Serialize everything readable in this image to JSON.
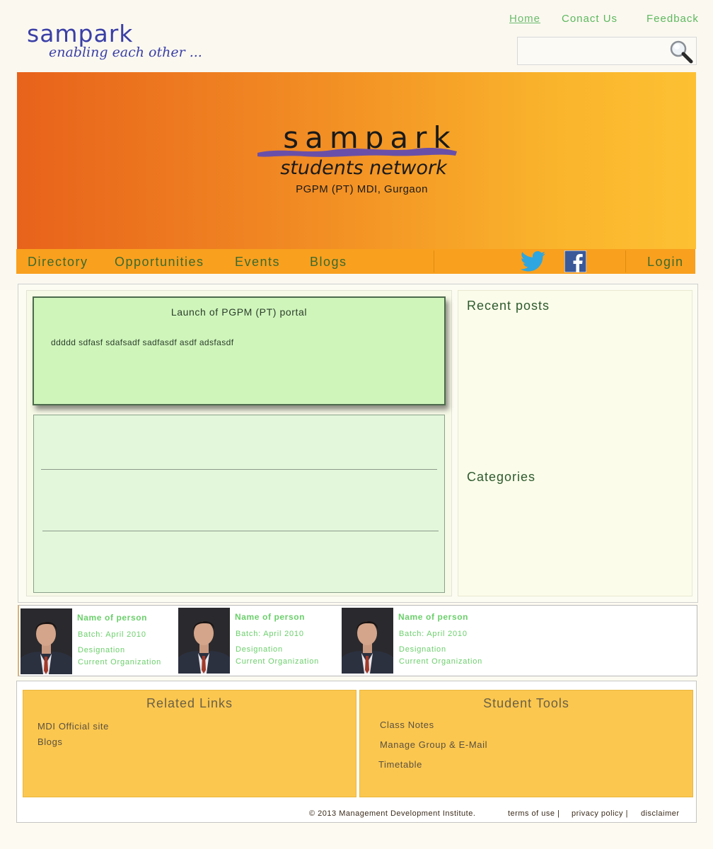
{
  "header": {
    "logo_text": "sampark",
    "logo_tagline": "enabling each other ...",
    "nav": {
      "home": "Home",
      "contact": "Conact Us",
      "feedback": "Feedback"
    },
    "search": {
      "value": "",
      "placeholder": ""
    }
  },
  "banner": {
    "title": "sampark",
    "subtitle": "students network",
    "org": "PGPM (PT) MDI, Gurgaon"
  },
  "main_nav": {
    "items": [
      "Directory",
      "Opportunities",
      "Events",
      "Blogs"
    ],
    "social_icons": [
      "twitter-icon",
      "facebook-icon"
    ],
    "login": "Login"
  },
  "news": {
    "title": "Launch of PGPM (PT) portal",
    "body": "ddddd sdfasf sdafsadf sadfasdf asdf adsfasdf"
  },
  "sidebar": {
    "recent_posts": "Recent posts",
    "categories": "Categories"
  },
  "people": [
    {
      "name": "Name of person",
      "batch": "Batch: April 2010",
      "designation": "Designation",
      "organization": "Current Organization"
    },
    {
      "name": "Name of person",
      "batch": "Batch: April 2010",
      "designation": "Designation",
      "organization": "Current Organization"
    },
    {
      "name": "Name of person",
      "batch": "Batch: April 2010",
      "designation": "Designation",
      "organization": "Current Organization"
    }
  ],
  "footer": {
    "related_links": {
      "title": "Related Links",
      "items": [
        "MDI Official site",
        "Blogs"
      ]
    },
    "student_tools": {
      "title": "Student Tools",
      "items": [
        "Class Notes",
        "Manage Group & E-Mail",
        "Timetable"
      ]
    },
    "copyright": "© 2013 Management Development Institute.",
    "legal": [
      "terms of use |",
      "privacy policy |",
      "disclaimer"
    ]
  },
  "colors": {
    "brand_blue": "#3a3fa6",
    "nav_green": "#5cb85c",
    "banner_orange": "#e8621b",
    "banner_yellow": "#fdc033",
    "navbar_orange": "#f9a01e",
    "card_green": "#cff5bb",
    "footer_yellow": "#fbc74f"
  }
}
